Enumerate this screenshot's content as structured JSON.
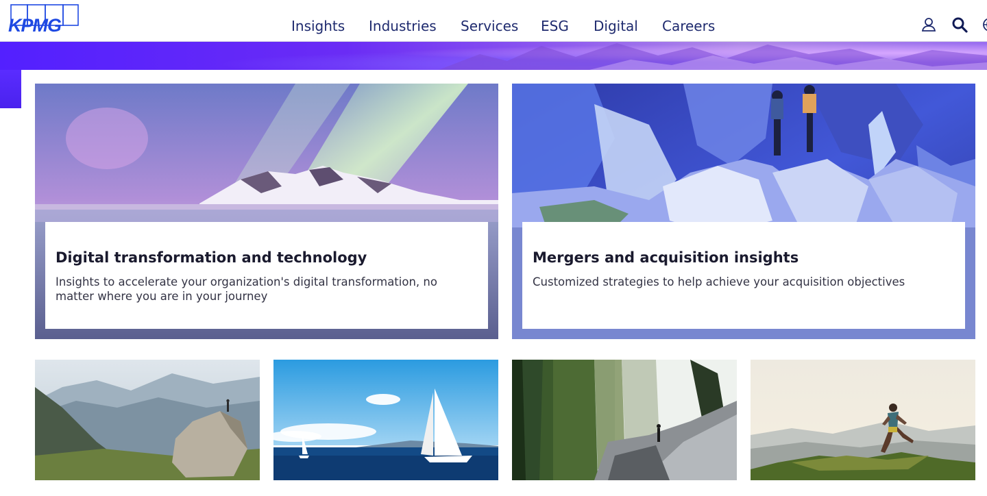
{
  "brand": {
    "logo_text": "KPMG",
    "color": "#1E49E2"
  },
  "nav": {
    "items": [
      {
        "label": "Insights"
      },
      {
        "label": "Industries"
      },
      {
        "label": "Services"
      },
      {
        "label": "ESG"
      },
      {
        "label": "Digital"
      },
      {
        "label": "Careers"
      }
    ]
  },
  "header_icons": [
    "user-icon",
    "search-icon",
    "globe-icon"
  ],
  "features": [
    {
      "title": "Digital transformation and technology",
      "description": "Insights to accelerate your organization's digital transformation, no matter where you are in your journey",
      "image": "aurora-over-snowy-mountain"
    },
    {
      "title": "Mergers and acquisition insights",
      "description": "Customized strategies to help achieve your acquisition objectives",
      "image": "hikers-on-rocky-cliff"
    }
  ],
  "tiles": [
    {
      "image": "hiker-on-boulder-mountains"
    },
    {
      "image": "sailboat-on-ocean"
    },
    {
      "image": "waterfall-forest-hiker"
    },
    {
      "image": "runner-on-hilltop"
    }
  ],
  "colors": {
    "nav_text": "#1E2A6E",
    "accent_purple": "#5320FF"
  }
}
